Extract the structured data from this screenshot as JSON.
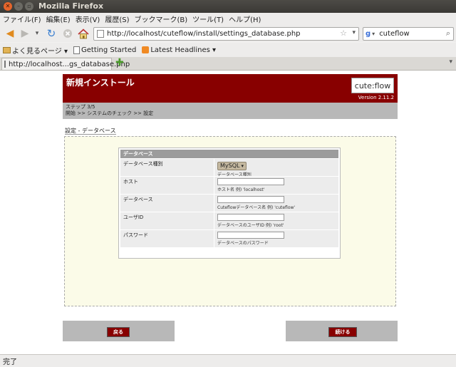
{
  "window": {
    "title": "Mozilla Firefox"
  },
  "menu": [
    "ファイル(F)",
    "編集(E)",
    "表示(V)",
    "履歴(S)",
    "ブックマーク(B)",
    "ツール(T)",
    "ヘルプ(H)"
  ],
  "nav": {
    "url": "http://localhost/cuteflow/install/settings_database.php",
    "search_value": "cuteflow"
  },
  "bookmarks": [
    {
      "label": "よく見るページ ▾"
    },
    {
      "label": "Getting Started"
    },
    {
      "label": "Latest Headlines ▾"
    }
  ],
  "tab": {
    "label": "http://localhost...gs_database.php"
  },
  "page": {
    "header_title": "新規インストール",
    "logo_text": "cute:flow",
    "version": "Version 2.11.2",
    "step_line": "ステップ 3/5",
    "progress_line": "開始 >> システムのチェック >> 設定",
    "crumb": "設定 - データベース",
    "table": {
      "heading": "データベース",
      "rows": [
        {
          "label": "データベース種別",
          "select": "MySQL",
          "hint": "データベース種別"
        },
        {
          "label": "ホスト",
          "hint": "ホスト名 例) 'localhost'"
        },
        {
          "label": "データベース",
          "hint": "Cuteflowデータベース名 例) 'cuteflow'"
        },
        {
          "label": "ユーザID",
          "hint": "データベースのユーザID 例) 'root'"
        },
        {
          "label": "パスワード",
          "hint": "データベースのパスワード"
        }
      ]
    },
    "back_label": "戻る",
    "next_label": "続ける"
  },
  "status": "完了"
}
